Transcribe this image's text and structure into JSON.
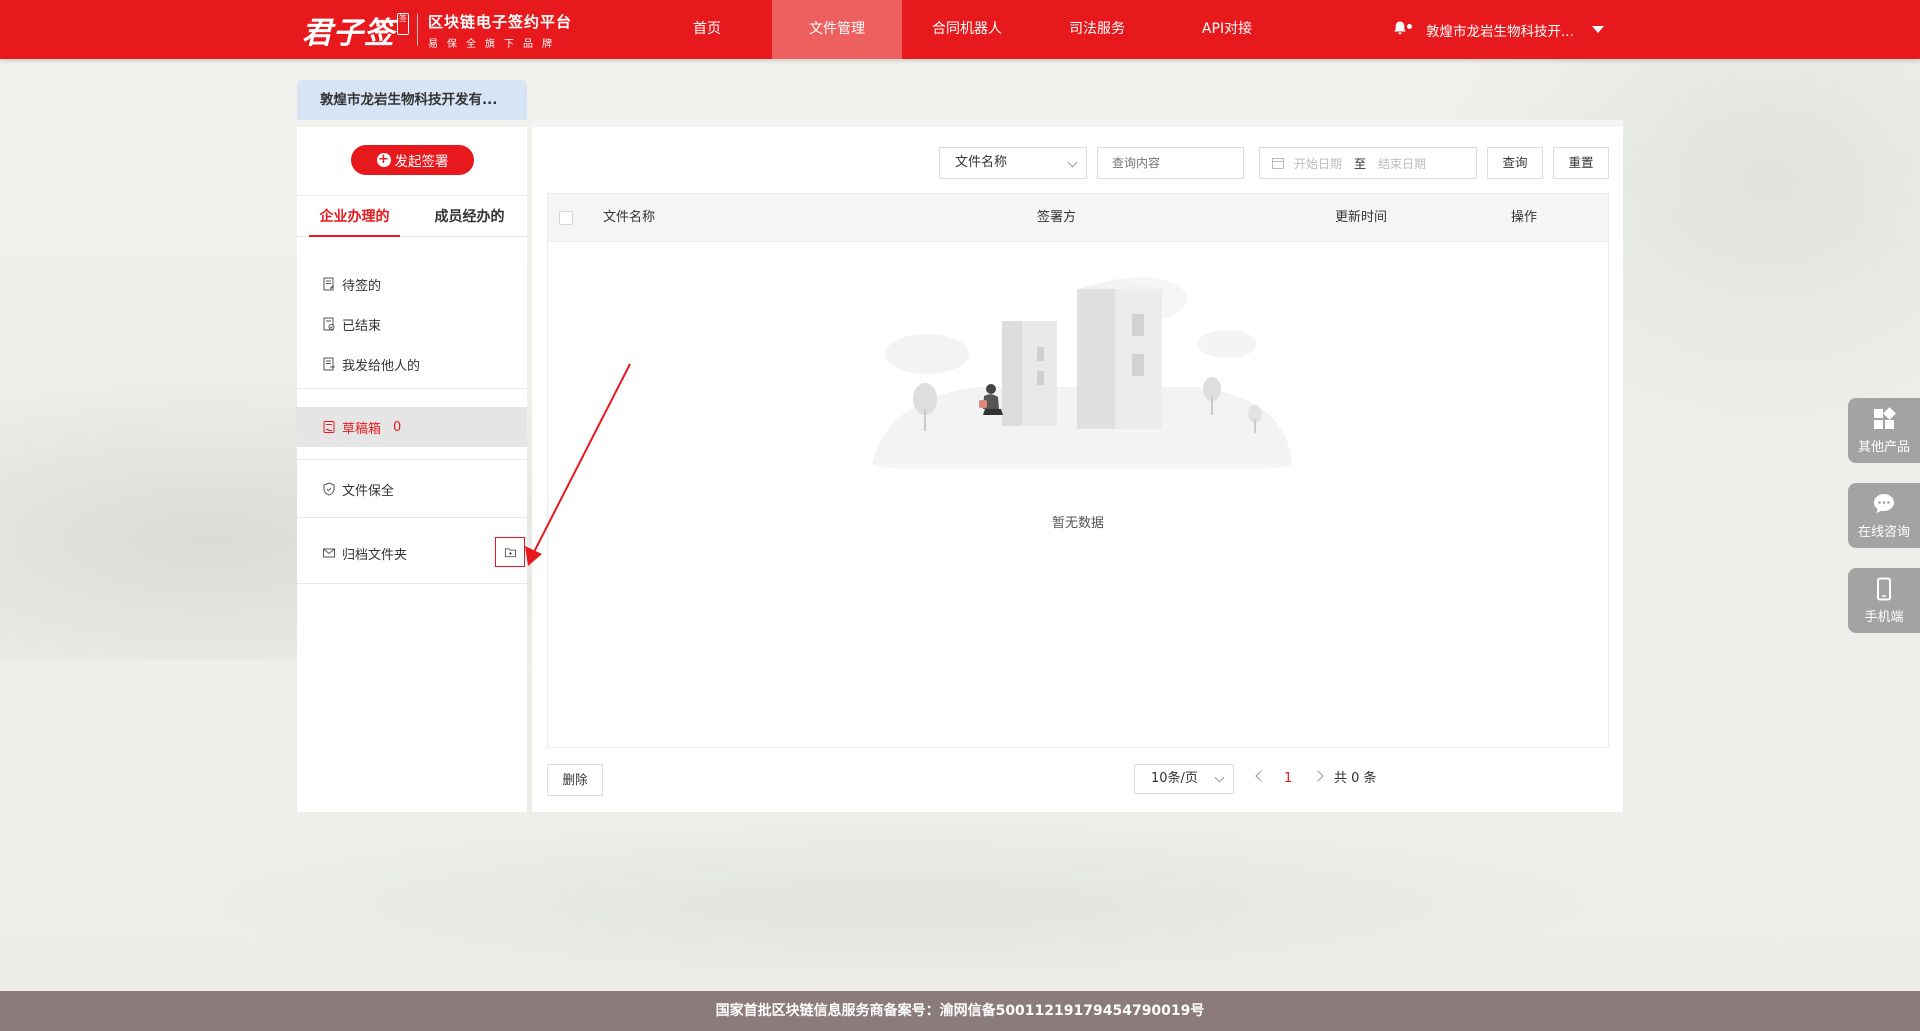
{
  "header": {
    "logo_main": "君子签",
    "logo_seal": "签",
    "logo_title": "区块链电子签约平台",
    "logo_subtitle": "易保全旗下品牌",
    "nav": [
      {
        "label": "首页"
      },
      {
        "label": "文件管理"
      },
      {
        "label": "合同机器人"
      },
      {
        "label": "司法服务"
      },
      {
        "label": "API对接"
      }
    ],
    "active_nav": "文件管理",
    "company_name": "敦煌市龙岩生物科技开..."
  },
  "company_tab": "敦煌市龙岩生物科技开发有...",
  "sidebar": {
    "start_button": "发起签署",
    "tabs": [
      {
        "label": "企业办理的"
      },
      {
        "label": "成员经办的"
      }
    ],
    "menu": [
      {
        "label": "待签的",
        "icon": "document-edit-icon"
      },
      {
        "label": "已结束",
        "icon": "document-check-icon"
      },
      {
        "label": "我发给他人的",
        "icon": "document-send-icon"
      }
    ],
    "drafts": {
      "label": "草稿箱",
      "count": "0",
      "icon": "draft-icon"
    },
    "preservation": {
      "label": "文件保全",
      "icon": "shield-check-icon"
    },
    "archive": {
      "label": "归档文件夹",
      "icon": "envelope-icon"
    }
  },
  "filters": {
    "field_select": "文件名称",
    "search_placeholder": "查询内容",
    "start_date_placeholder": "开始日期",
    "date_separator": "至",
    "end_date_placeholder": "结束日期",
    "query_button": "查询",
    "reset_button": "重置"
  },
  "table": {
    "columns": [
      "文件名称",
      "签署方",
      "更新时间",
      "操作"
    ],
    "rows": [],
    "empty_text": "暂无数据"
  },
  "pagination": {
    "delete_button": "删除",
    "page_size": "10条/页",
    "current_page": "1",
    "total": "共 0 条"
  },
  "floating": [
    {
      "label": "其他产品",
      "icon": "grid-icon"
    },
    {
      "label": "在线咨询",
      "icon": "chat-icon"
    },
    {
      "label": "手机端",
      "icon": "phone-icon"
    }
  ],
  "footer": "国家首批区块链信息服务商备案号：渝网信备50011219179454790019号",
  "colors": {
    "brand_red": "#e8191d",
    "nav_active": "#ee5f5f",
    "footer_bg": "#8c7b7b",
    "tab_bg": "#d6e4f5"
  }
}
